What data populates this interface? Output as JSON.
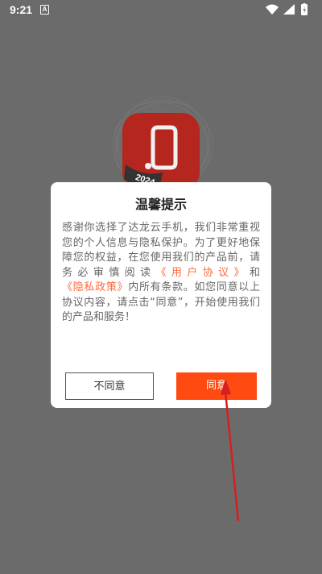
{
  "status_bar": {
    "time": "9:21",
    "notification_glyph": "A",
    "icons": [
      "wifi-icon",
      "signal-icon",
      "battery-icon"
    ]
  },
  "background": {
    "app_icon": "dalongyun-phone-app-icon",
    "badge_text": "2024"
  },
  "dialog": {
    "title": "温馨提示",
    "body": {
      "part1": "感谢你选择了达龙云手机，我们非常重视您的个人信息与隐私保护。为了更好地保障您的权益，在您使用我们的产品前，请务必审慎阅读",
      "link_user_agreement": "《用户协议》",
      "part2": "和",
      "link_privacy_policy": "《隐私政策》",
      "part3": "内所有条款。如您同意以上协议内容，请点击“同意”，开始使用我们的产品和服务！"
    },
    "disagree_label": "不同意",
    "agree_label": "同意"
  },
  "colors": {
    "overlay": "#6b6b6b",
    "accent": "#ff4a12",
    "link": "#ff6a3d",
    "annotation_arrow": "#d42020"
  }
}
